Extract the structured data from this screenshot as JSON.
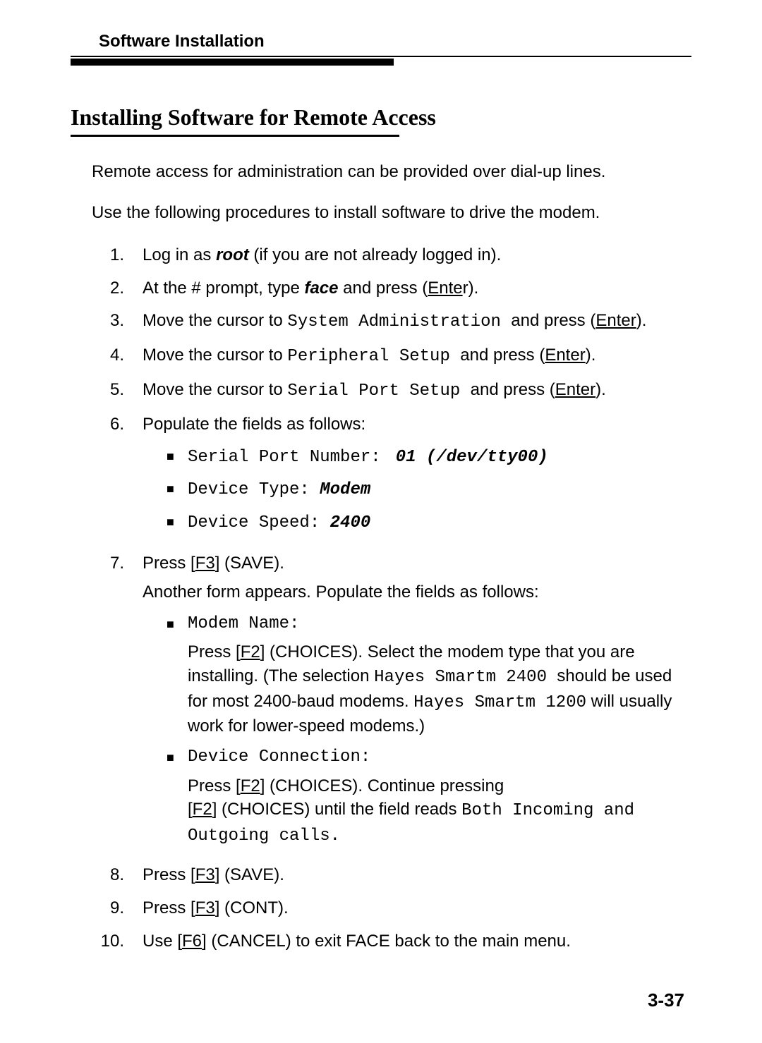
{
  "header": {
    "running_head": "Software Installation"
  },
  "section": {
    "title": "Installing Software for Remote Access"
  },
  "intro1": "Remote access for administration can be provided over dial-up lines.",
  "intro2": "Use the following procedures to install software to drive the modem.",
  "steps": {
    "s1": {
      "num": "1.",
      "a": "Log in as ",
      "b": "root",
      "c": " (if you are not already logged in)."
    },
    "s2": {
      "num": "2.",
      "a": "At the # prompt, type ",
      "b": "face",
      "c": " and press (",
      "d": "Ente",
      "e": "r)."
    },
    "s3": {
      "num": "3.",
      "a": "Move the cursor to ",
      "b": "System Administration ",
      "c": " and press (",
      "d": "Enter",
      "e": ")."
    },
    "s4": {
      "num": "4.",
      "a": "Move the cursor to ",
      "b": "Peripheral Setup ",
      "c": " and press (",
      "d": "Enter",
      "e": ")."
    },
    "s5": {
      "num": "5.",
      "a": "Move the cursor to ",
      "b": "Serial Port Setup ",
      "c": " and press (",
      "d": "Enter",
      "e": ")."
    },
    "s6": {
      "num": "6.",
      "lead": "Populate the fields as follows:",
      "b1": {
        "label": "Serial  Port  Number: ",
        "val": "01      (/dev/tty00)"
      },
      "b2": {
        "label": "Device  Type: ",
        "val": "Modem"
      },
      "b3": {
        "label": "Device  Speed: ",
        "val": "2400"
      }
    },
    "s7": {
      "num": "7.",
      "a": "Press [",
      "b": "F3",
      "c": "] (SAVE).",
      "after": "Another form appears. Populate the fields as follows:",
      "b1": {
        "label": "Modem Name:",
        "p1a": "Press [",
        "p1b": "F2",
        "p1c": "] (CHOICES). Select the modem type that you are installing. (The selection ",
        "p1d": "Hayes Smartm 2400 ",
        "p1e": " should be used for most 2400-baud modems. ",
        "p1f": "Hayes Smartm 1200",
        "p1g": " will usually work for lower-speed modems.)"
      },
      "b2": {
        "label": "Device Connection:",
        "p1a": "Press [",
        "p1b": "F2",
        "p1c": "] (CHOICES). Continue pressing",
        "p2a": " [",
        "p2b": "F2",
        "p2c": "] (CHOICES) until the field reads ",
        "p2d": "Both Incoming and Outgoing calls."
      }
    },
    "s8": {
      "num": "8.",
      "a": "Press [",
      "b": "F3",
      "c": "] (SAVE)."
    },
    "s9": {
      "num": "9.",
      "a": "Press [",
      "b": "F3",
      "c": "] (CONT)."
    },
    "s10": {
      "num": "10.",
      "a": "Use [",
      "b": "F6",
      "c": "] (CANCEL) to exit FACE back to the main menu."
    }
  },
  "page_number": "3-37"
}
